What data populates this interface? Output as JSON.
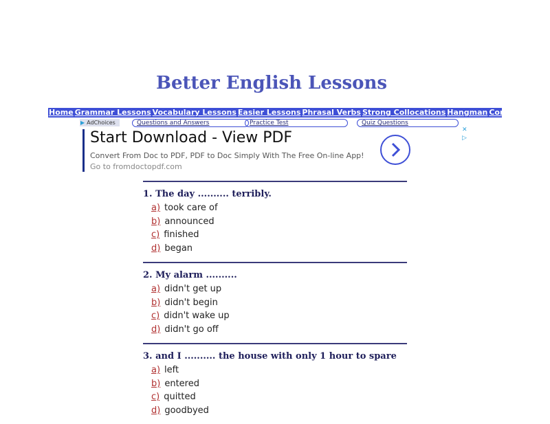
{
  "site": {
    "title": "Better English Lessons"
  },
  "nav": {
    "items": [
      "Home",
      "Grammar Lessons",
      "Vocabulary Lessons",
      "Easier Lessons",
      "Phrasal Verbs",
      "Strong Collocations",
      "Hangman",
      "Contact"
    ]
  },
  "subnav": {
    "adchoices": "AdChoices",
    "items": [
      "Questions and Answers",
      "Practice Test",
      "Quiz Questions"
    ]
  },
  "ad": {
    "title": "Start Download - View PDF",
    "description": "Convert From Doc to PDF, PDF to Doc Simply With The Free On-line App!",
    "url": "Go to fromdoctopdf.com",
    "close_glyph": "✕",
    "info_glyph": "▷"
  },
  "quiz": {
    "questions": [
      {
        "text": "1. The day .......... terribly.",
        "answers": [
          {
            "key": "a)",
            "text": "took care of"
          },
          {
            "key": "b)",
            "text": "announced"
          },
          {
            "key": "c)",
            "text": "finished"
          },
          {
            "key": "d)",
            "text": "began"
          }
        ]
      },
      {
        "text": "2. My alarm ..........",
        "answers": [
          {
            "key": "a)",
            "text": "didn't get up"
          },
          {
            "key": "b)",
            "text": "didn't begin"
          },
          {
            "key": "c)",
            "text": "didn't wake up"
          },
          {
            "key": "d)",
            "text": "didn't go off"
          }
        ]
      },
      {
        "text": "3. and I .......... the house with only 1 hour to spare",
        "answers": [
          {
            "key": "a)",
            "text": "left"
          },
          {
            "key": "b)",
            "text": "entered"
          },
          {
            "key": "c)",
            "text": "quitted"
          },
          {
            "key": "d)",
            "text": "goodbyed"
          }
        ]
      }
    ]
  },
  "colors": {
    "nav": "#3e4fd6",
    "title": "#4b55b8",
    "answer_key": "#b03030"
  }
}
